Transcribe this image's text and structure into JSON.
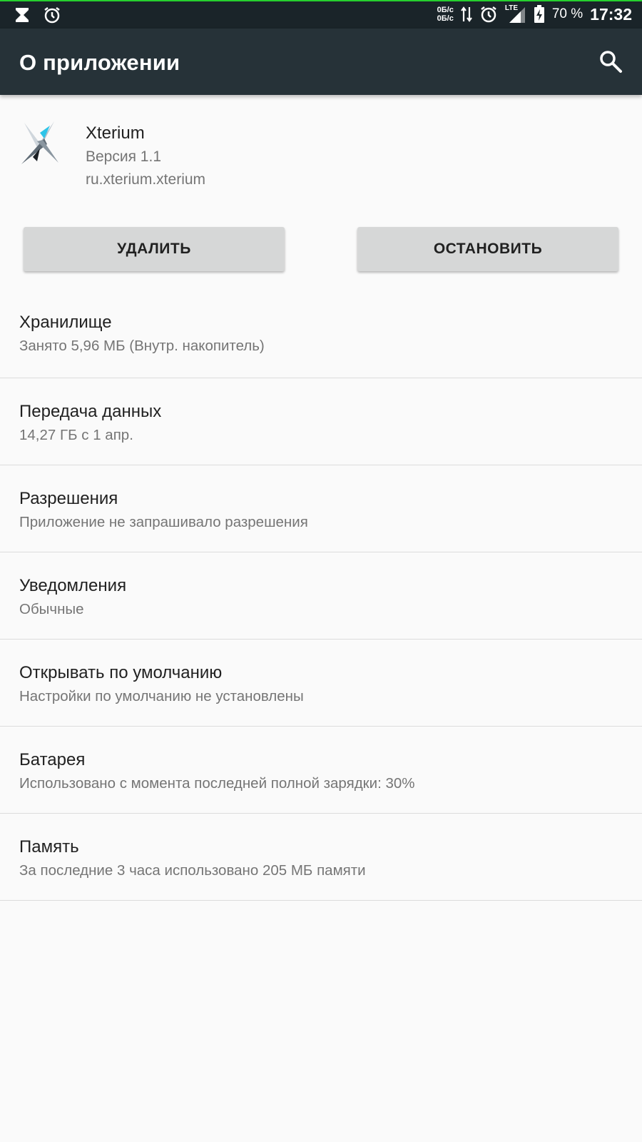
{
  "status_bar": {
    "net_up": "0Б/с",
    "net_down": "0Б/с",
    "network_type": "LTE",
    "battery_percent": "70 %",
    "time": "17:32",
    "icons": [
      "hourglass-icon",
      "alarm-icon",
      "data-arrows-icon",
      "alarm-icon",
      "signal-icon",
      "battery-charging-icon"
    ]
  },
  "toolbar": {
    "title": "О приложении",
    "search_icon": "search-icon"
  },
  "app": {
    "name": "Xterium",
    "version": "Версия 1.1",
    "package": "ru.xterium.xterium"
  },
  "buttons": {
    "uninstall": "УДАЛИТЬ",
    "stop": "ОСТАНОВИТЬ"
  },
  "settings": [
    {
      "title": "Хранилище",
      "subtitle": "Занято 5,96 МБ (Внутр. накопитель)"
    },
    {
      "title": "Передача данных",
      "subtitle": "14,27 ГБ с 1 апр."
    },
    {
      "title": "Разрешения",
      "subtitle": "Приложение не запрашивало разрешения"
    },
    {
      "title": "Уведомления",
      "subtitle": "Обычные"
    },
    {
      "title": "Открывать по умолчанию",
      "subtitle": "Настройки по умолчанию не установлены"
    },
    {
      "title": "Батарея",
      "subtitle": "Использовано с момента последней полной зарядки: 30%"
    },
    {
      "title": "Память",
      "subtitle": "За последние 3 часа использовано 205 МБ памяти"
    }
  ],
  "colors": {
    "toolbar": "#263238",
    "status_bar": "#1a2429",
    "button": "#d6d7d7",
    "background": "#fafafa"
  }
}
